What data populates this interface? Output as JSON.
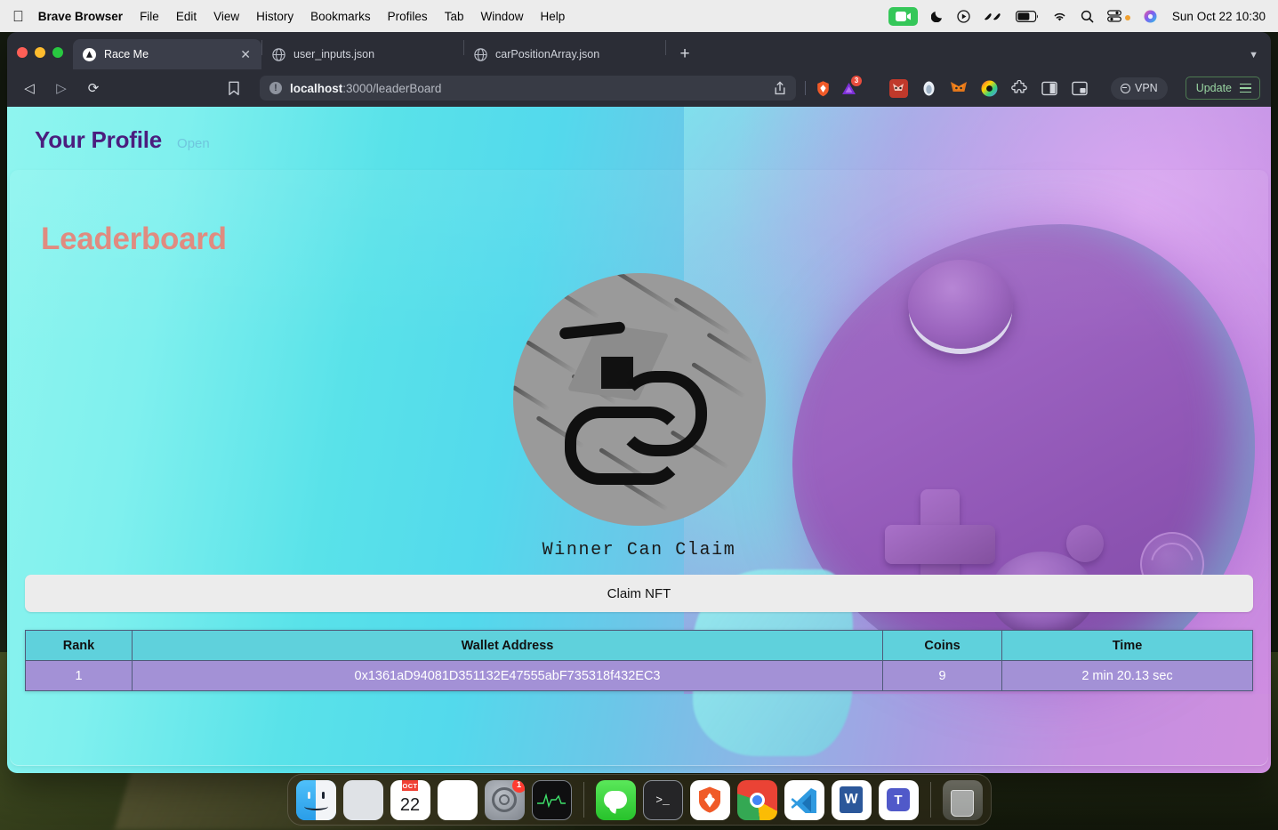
{
  "menubar": {
    "apple_icon": "apple-logo",
    "app_name": "Brave Browser",
    "items": [
      "File",
      "Edit",
      "View",
      "History",
      "Bookmarks",
      "Profiles",
      "Tab",
      "Window",
      "Help"
    ],
    "status_icons": [
      "screen-recording-icon",
      "focus-moon-icon",
      "now-playing-icon",
      "bluetooth-headphones-icon",
      "battery-icon",
      "wifi-icon",
      "spotlight-search-icon",
      "control-center-icon",
      "siri-icon"
    ],
    "clock": "Sun Oct 22  10:30"
  },
  "browser": {
    "tabs": [
      {
        "title": "Race Me",
        "favicon": "brave-triangle-icon",
        "active": true,
        "close_label": "✕"
      },
      {
        "title": "user_inputs.json",
        "favicon": "globe-icon",
        "active": false
      },
      {
        "title": "carPositionArray.json",
        "favicon": "globe-icon",
        "active": false
      }
    ],
    "new_tab_label": "+",
    "tab_list_chevron": "▼",
    "nav": {
      "back": "◁",
      "forward": "▷",
      "reload": "⟳",
      "bookmark": "bookmark-icon"
    },
    "url": {
      "host": "localhost",
      "rest": ":3000/leaderBoard",
      "info_icon": "!"
    },
    "toolbar_right": {
      "share_icon": "share-icon",
      "brave_shield_icon": "brave-lion-icon",
      "brave_rewards_icon": "brave-rewards-triangle-icon",
      "rewards_count": "3",
      "extensions": [
        "metamask-fox-red-icon",
        "ethereum-wallet-icon",
        "metamask-fox-icon",
        "rainbow-wallet-icon",
        "puzzle-extensions-icon",
        "sidebar-panel-icon",
        "picture-in-picture-icon"
      ],
      "vpn_label": "VPN",
      "update_label": "Update",
      "menu_icon": "hamburger-menu-icon"
    }
  },
  "page": {
    "profile_title": "Your Profile",
    "profile_open_link": "Open",
    "leaderboard_title": "Leaderboard",
    "nft_image_alt": "nft-race-track-artwork",
    "winner_text": "Winner Can Claim",
    "claim_button": "Claim NFT",
    "table": {
      "columns": [
        "Rank",
        "Wallet Address",
        "Coins",
        "Time"
      ],
      "rows": [
        {
          "rank": "1",
          "wallet": "0x1361aD94081D351132E47555abF735318f432EC3",
          "coins": "9",
          "time": "2 min 20.13 sec"
        }
      ]
    },
    "colors": {
      "profile_title": "#4b1d7e",
      "profile_open": "#6fc6dd",
      "leaderboard_title": "#e08b80",
      "table_header_bg": "#5fd1dc",
      "table_row_bg": "#a391d6",
      "claim_button_bg": "#ececec"
    }
  },
  "dock": {
    "apps": [
      {
        "name": "Finder",
        "running": true
      },
      {
        "name": "Launchpad",
        "running": false
      },
      {
        "name": "Calendar",
        "month": "OCT",
        "day": "22",
        "running": false
      },
      {
        "name": "Notes",
        "running": true
      },
      {
        "name": "System Settings",
        "badge": "1",
        "running": false
      },
      {
        "name": "Activity Monitor",
        "running": true
      },
      {
        "name": "Messages",
        "running": true
      },
      {
        "name": "Terminal",
        "running": true
      },
      {
        "name": "Brave Browser",
        "running": true
      },
      {
        "name": "Google Chrome",
        "running": true
      },
      {
        "name": "Visual Studio Code",
        "running": true
      },
      {
        "name": "Microsoft Word",
        "running": true
      },
      {
        "name": "Microsoft Teams",
        "running": true
      }
    ],
    "trash": "Trash"
  }
}
